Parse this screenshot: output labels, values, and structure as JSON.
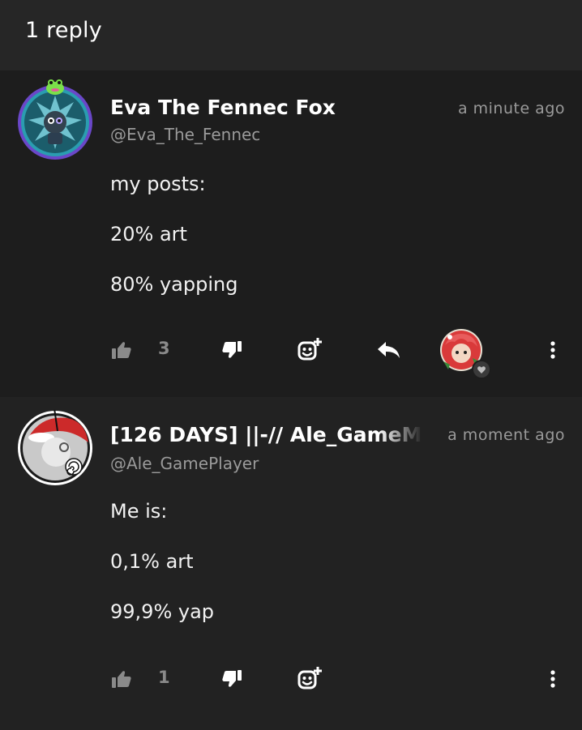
{
  "header": {
    "title": "1 reply"
  },
  "posts": [
    {
      "name": "Eva The Fennec Fox",
      "handle": "@Eva_The_Fennec",
      "time": "a minute ago",
      "lines": [
        "my posts:",
        "20% art",
        "80% yapping"
      ],
      "likes": "3",
      "avatar_ring_color": "#6a47c8",
      "avatar_bg": "#1f6f7a"
    },
    {
      "name": "[126 DAYS] ||-// Ale_GameM",
      "handle": "@Ale_GamePlayer",
      "time": "a moment ago",
      "lines": [
        "Me is:",
        "0,1% art",
        "99,9% yap"
      ],
      "likes": "1",
      "avatar_ring_color": "#ffffff",
      "avatar_bg": "#cc2a2a"
    }
  ],
  "icons": {
    "like": "thumbs-up-icon",
    "dislike": "thumbs-down-icon",
    "react": "add-reaction-icon",
    "reply": "reply-icon",
    "more": "more-vertical-icon",
    "heart": "heart-icon"
  },
  "colors": {
    "background": "#1c1c1c",
    "header_bg": "#262626",
    "muted_text": "#9a9a9a",
    "icon_color": "#ffffff"
  }
}
